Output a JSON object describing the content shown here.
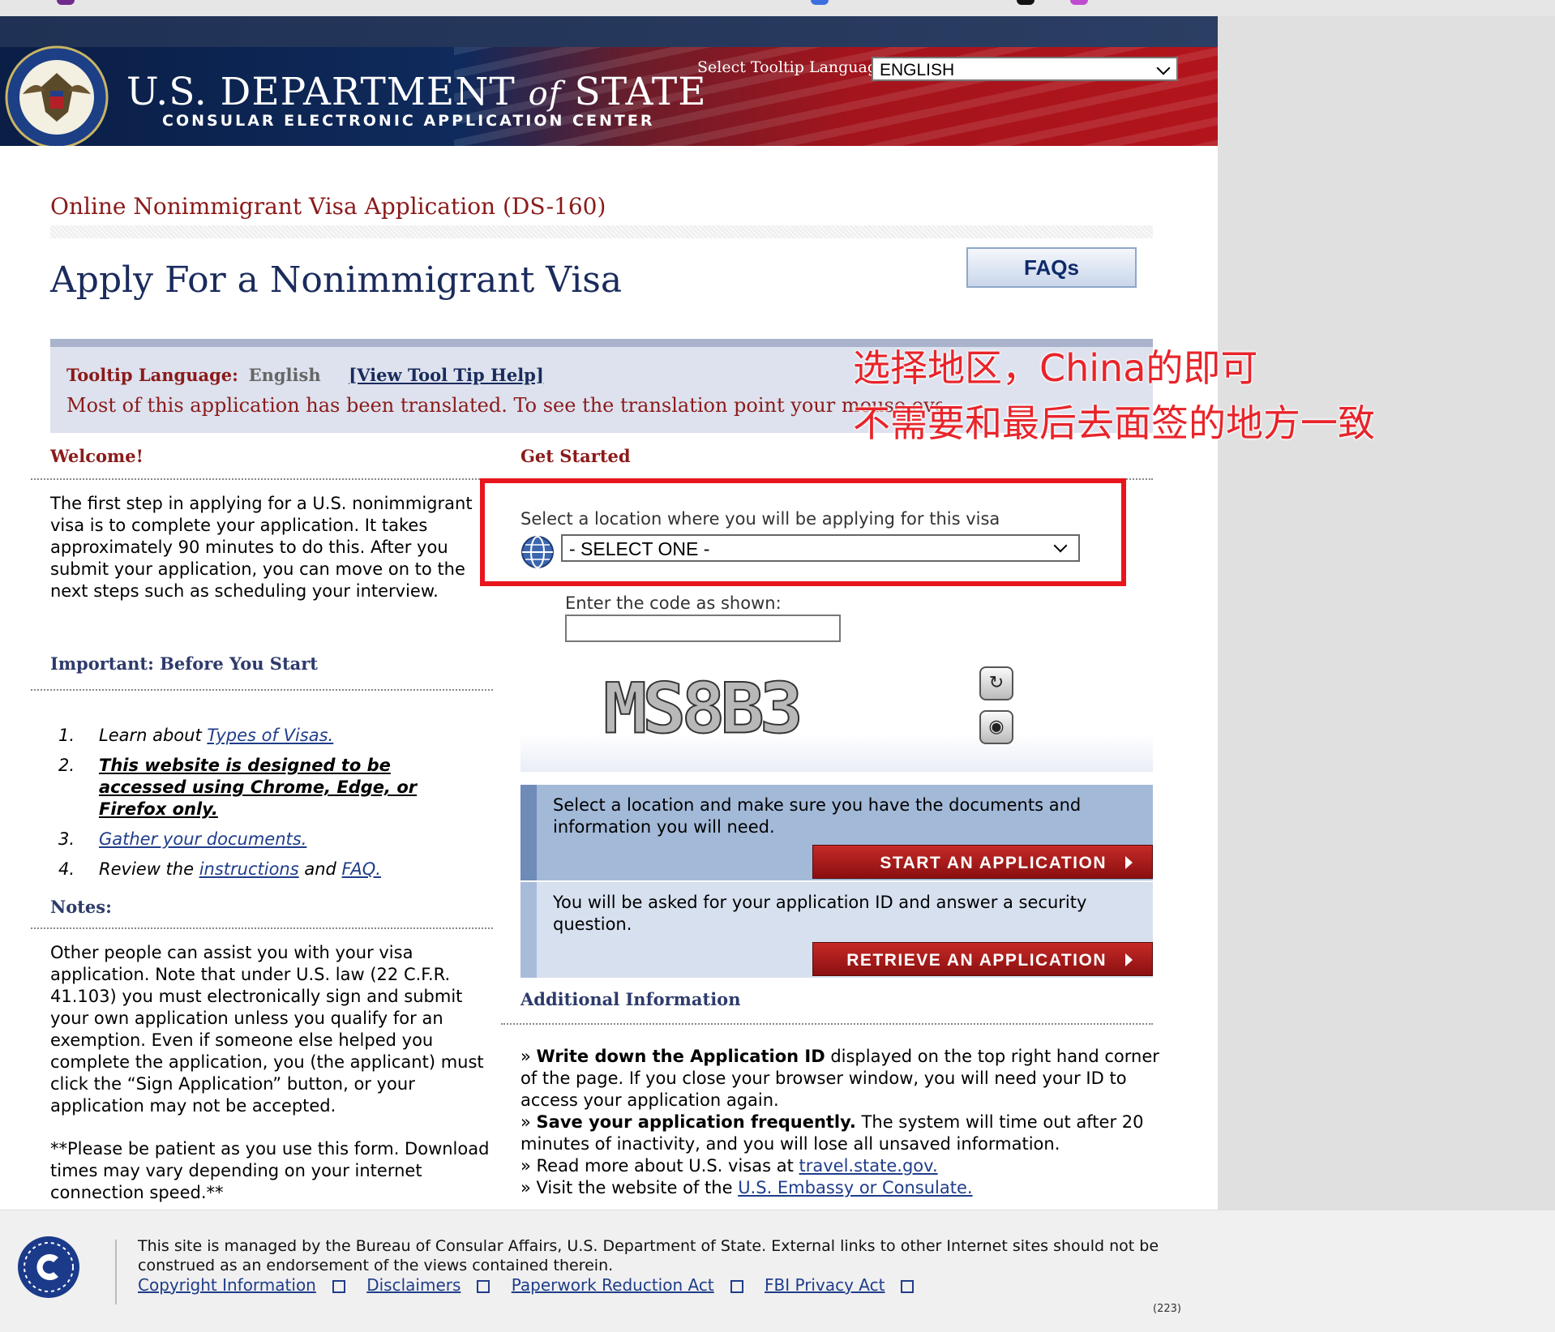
{
  "header": {
    "dept_title_pre": "U.S. DEPARTMENT",
    "dept_title_of": "of",
    "dept_title_post": "STATE",
    "dept_subtitle": "CONSULAR ELECTRONIC APPLICATION CENTER",
    "tooltip_language_label": "Select Tooltip Language",
    "tooltip_language_value": "ENGLISH"
  },
  "form_title": "Online Nonimmigrant Visa Application (DS-160)",
  "page_title": "Apply For a Nonimmigrant Visa",
  "faq_button": "FAQs",
  "tooltip_band": {
    "label": "Tooltip Language:",
    "language": "English",
    "help_link": "[View Tool Tip Help]",
    "message": "Most of this application has been translated. To see the translation point your mouse over"
  },
  "welcome": {
    "heading": "Welcome!",
    "text": "The first step in applying for a U.S. nonimmigrant visa is to complete your application. It takes approximately 90 minutes to do this. After you submit your application, you can move on to the next steps such as scheduling your interview."
  },
  "important": {
    "heading": "Important: Before You Start",
    "steps": [
      {
        "num": "1.",
        "pre": "Learn about ",
        "link": "Types of Visas."
      },
      {
        "num": "2.",
        "bold_link": "This website is designed to be accessed using Chrome, Edge, or Firefox only."
      },
      {
        "num": "3.",
        "link": "Gather your documents."
      },
      {
        "num": "4.",
        "pre": "Review the ",
        "link": "instructions",
        "mid": " and ",
        "link2": "FAQ."
      }
    ]
  },
  "notes": {
    "heading": "Notes:",
    "text1": "Other people can assist you with your visa application. Note that under U.S. law (22 C.F.R. 41.103) you must electronically sign and submit your own application unless you qualify for an exemption. Even if someone else helped you complete the application, you (the applicant) must click the “Sign Application” button, or your application may not be accepted.",
    "text2": "**Please be patient as you use this form. Download times may vary depending on your internet connection speed.**"
  },
  "get_started": {
    "heading": "Get Started",
    "location_label": "Select a location where you will be applying for this visa",
    "location_value": "- SELECT ONE -",
    "code_label": "Enter the code as shown:",
    "code_value": "",
    "captcha_text": "MS8B3",
    "refresh_icon": "↻",
    "audio_icon": "◉"
  },
  "start_box": {
    "text": "Select a location and make sure you have the documents and information you will need.",
    "button": "START AN APPLICATION"
  },
  "retrieve_box": {
    "text": "You will be asked for your application ID and answer a security question.",
    "button": "RETRIEVE AN APPLICATION"
  },
  "additional": {
    "heading": "Additional Information",
    "l1_bold": "Write down the Application ID",
    "l1_rest": " displayed on the top right hand corner of the page. If you close your browser window, you will need your ID to access your application again.",
    "l2_bold": "Save your application frequently.",
    "l2_rest": " The system will time out after 20 minutes of inactivity, and you will lose all unsaved information.",
    "l3_pre": "Read more about U.S. visas at ",
    "l3_link": "travel.state.gov.",
    "l4_pre": "Visit the website of the ",
    "l4_link": "U.S. Embassy or Consulate."
  },
  "annotation": {
    "line1": "选择地区，China的即可",
    "line2": "不需要和最后去面签的地方一致"
  },
  "footer": {
    "text": "This site is managed by the Bureau of Consular Affairs, U.S. Department of State. External links to other Internet sites should not be construed as an endorsement of the views contained therein.",
    "links": [
      "Copyright Information",
      "Disclaimers",
      "Paperwork Reduction Act",
      "FBI Privacy Act"
    ],
    "code": "(223)"
  },
  "colors": {
    "accent_red": "#8b1a1a",
    "navy": "#1a2b5c",
    "annotation_red": "#e8151c",
    "button_red": "#b01c1c"
  }
}
